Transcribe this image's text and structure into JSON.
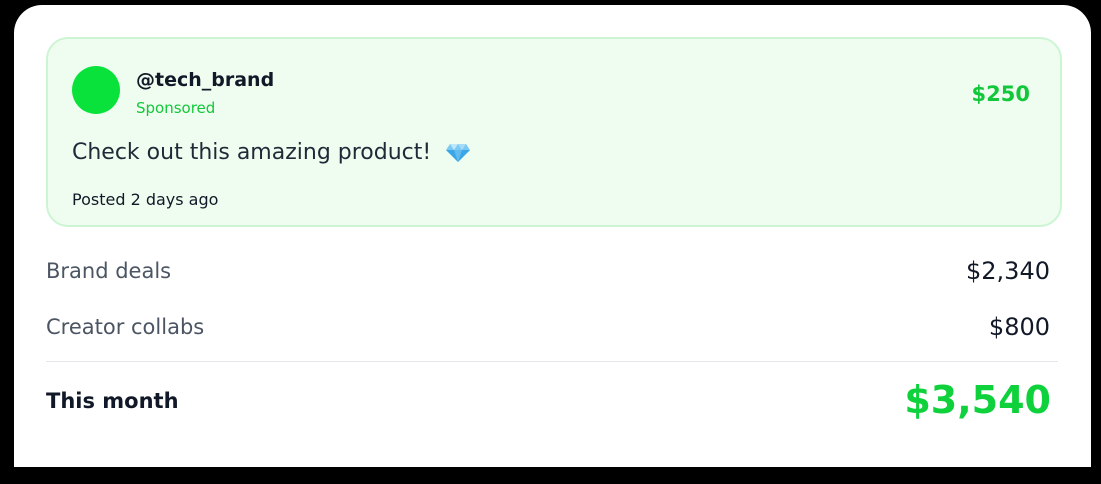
{
  "post": {
    "handle": "@tech_brand",
    "tag": "Sponsored",
    "amount": "$250",
    "message": "Check out this amazing product!",
    "emoji_icon": "gem-icon",
    "posted": "Posted 2 days ago"
  },
  "earnings": {
    "rows": [
      {
        "label": "Brand deals",
        "value": "$2,340"
      },
      {
        "label": "Creator collabs",
        "value": "$800"
      }
    ],
    "total_label": "This month",
    "total_value": "$3,540"
  },
  "colors": {
    "accent": "#12c83a",
    "post_background": "#effdf0",
    "avatar": "#0ae23c",
    "page_background": "#000000"
  }
}
